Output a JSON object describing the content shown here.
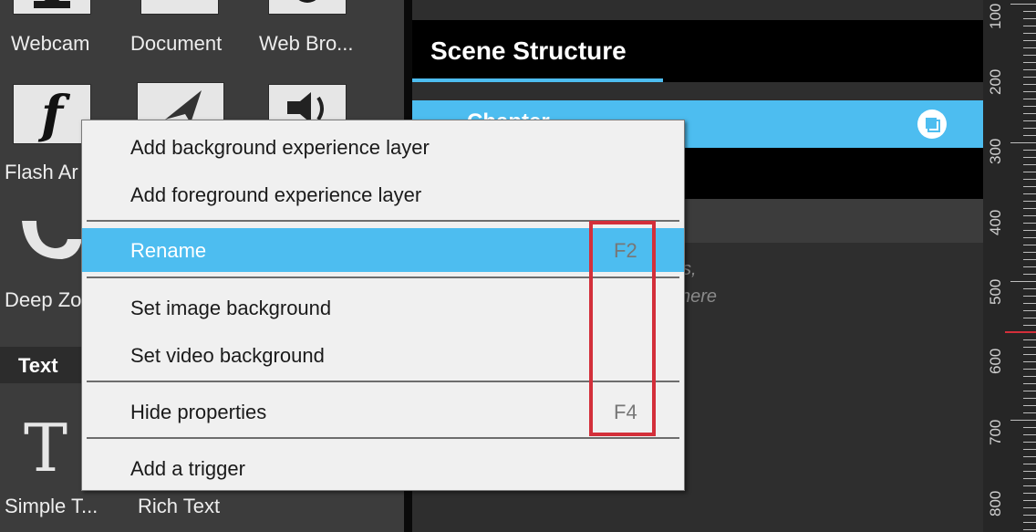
{
  "left_panel": {
    "tiles_row1": [
      "Webcam",
      "Document",
      "Web Bro..."
    ],
    "tiles_row2_first": "Flash Ar",
    "tiles_row3_first": "Deep Zo",
    "text_section": "Text",
    "tiles_row4": [
      "Simple T...",
      "Rich Text"
    ]
  },
  "scene": {
    "title": "Scene Structure",
    "selected_item": "Chapter",
    "hint_line1": "s,",
    "hint_line2": "here"
  },
  "ruler": {
    "labels": [
      "100",
      "200",
      "300",
      "400",
      "500",
      "600",
      "700",
      "800"
    ]
  },
  "menu": {
    "items": [
      {
        "label": "Add background experience layer",
        "shortcut": ""
      },
      {
        "label": "Add foreground experience layer",
        "shortcut": ""
      },
      {
        "label": "Rename",
        "shortcut": "F2"
      },
      {
        "label": "Set image background",
        "shortcut": ""
      },
      {
        "label": "Set video background",
        "shortcut": ""
      },
      {
        "label": "Hide properties",
        "shortcut": "F4"
      },
      {
        "label": "Add a trigger",
        "shortcut": ""
      }
    ]
  },
  "colors": {
    "accent": "#4dbdf0",
    "highlight_box": "#d32f3a"
  }
}
